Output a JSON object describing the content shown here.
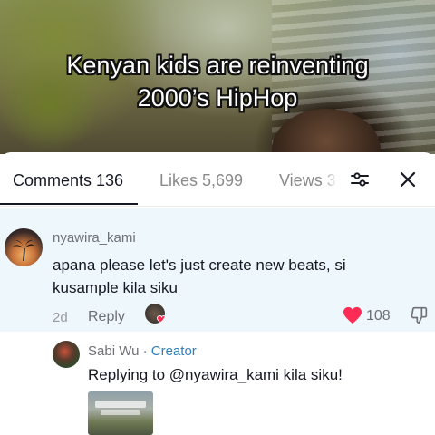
{
  "video": {
    "caption_line1": "Kenyan kids are reinventing",
    "caption_line2": "2000’s HipHop"
  },
  "tabs": [
    {
      "label": "Comments 136",
      "active": true
    },
    {
      "label": "Likes 5,699",
      "active": false
    },
    {
      "label": "Views 3",
      "active": false
    }
  ],
  "icons": {
    "filter": "filter-sliders-icon",
    "close": "close-icon",
    "like": "heart-icon",
    "dislike": "thumbs-down-icon"
  },
  "colors": {
    "highlight_bg": "#eef7fb",
    "like_red": "#fe2c55",
    "creator_blue": "#2f7fb9"
  },
  "comment": {
    "username": "nyawira_kami",
    "text": "apana please let's just create new beats, si kusample kila siku",
    "date": "2d",
    "reply_label": "Reply",
    "likes": "108",
    "liked": true
  },
  "reply": {
    "username": "Sabi Wu",
    "separator": " · ",
    "badge": "Creator",
    "text": "Replying to @nyawira_kami kila siku!"
  }
}
